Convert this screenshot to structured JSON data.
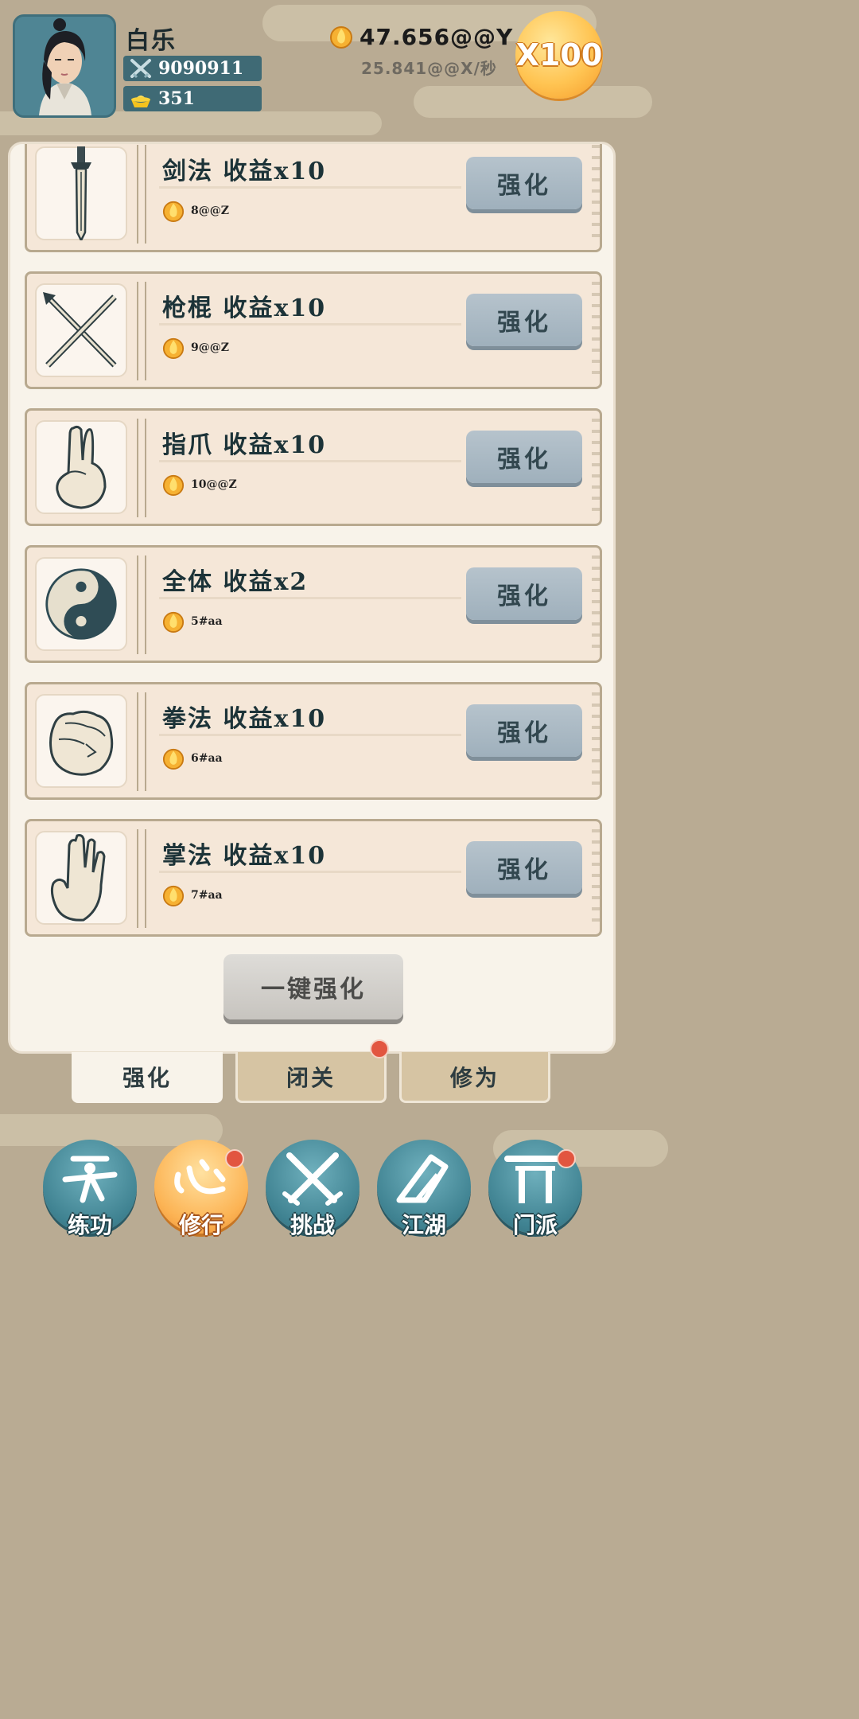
{
  "player": {
    "name": "白乐",
    "power": "9090911",
    "gold_ingots": "351"
  },
  "currency": {
    "total": "47.656@@Y",
    "rate": "25.841@@X/秒",
    "multiplier": "X100"
  },
  "upgrades": [
    {
      "title": "剑法 收益x10",
      "cost": "8@@Z",
      "button": "强化",
      "icon": "sword-icon"
    },
    {
      "title": "枪棍 收益x10",
      "cost": "9@@Z",
      "button": "强化",
      "icon": "spear-staff-icon"
    },
    {
      "title": "指爪 收益x10",
      "cost": "10@@Z",
      "button": "强化",
      "icon": "finger-claw-icon"
    },
    {
      "title": "全体 收益x2",
      "cost": "5#aa",
      "button": "强化",
      "icon": "yin-yang-icon"
    },
    {
      "title": "拳法 收益x10",
      "cost": "6#aa",
      "button": "强化",
      "icon": "fist-icon"
    },
    {
      "title": "掌法 收益x10",
      "cost": "7#aa",
      "button": "强化",
      "icon": "palm-icon"
    }
  ],
  "one_key_button": "一键强化",
  "sub_tabs": [
    {
      "label": "强化",
      "active": true
    },
    {
      "label": "闭关",
      "active": false,
      "badge": true
    },
    {
      "label": "修为",
      "active": false
    }
  ],
  "bottom_nav": [
    {
      "label": "练功",
      "active": false,
      "badge": false
    },
    {
      "label": "修行",
      "active": true,
      "badge": true
    },
    {
      "label": "挑战",
      "active": false,
      "badge": false
    },
    {
      "label": "江湖",
      "active": false,
      "badge": false
    },
    {
      "label": "门派",
      "active": false,
      "badge": true
    }
  ],
  "colors": {
    "accent_teal": "#3f8291",
    "accent_orange": "#fcb455",
    "badge_red": "#e25540"
  }
}
